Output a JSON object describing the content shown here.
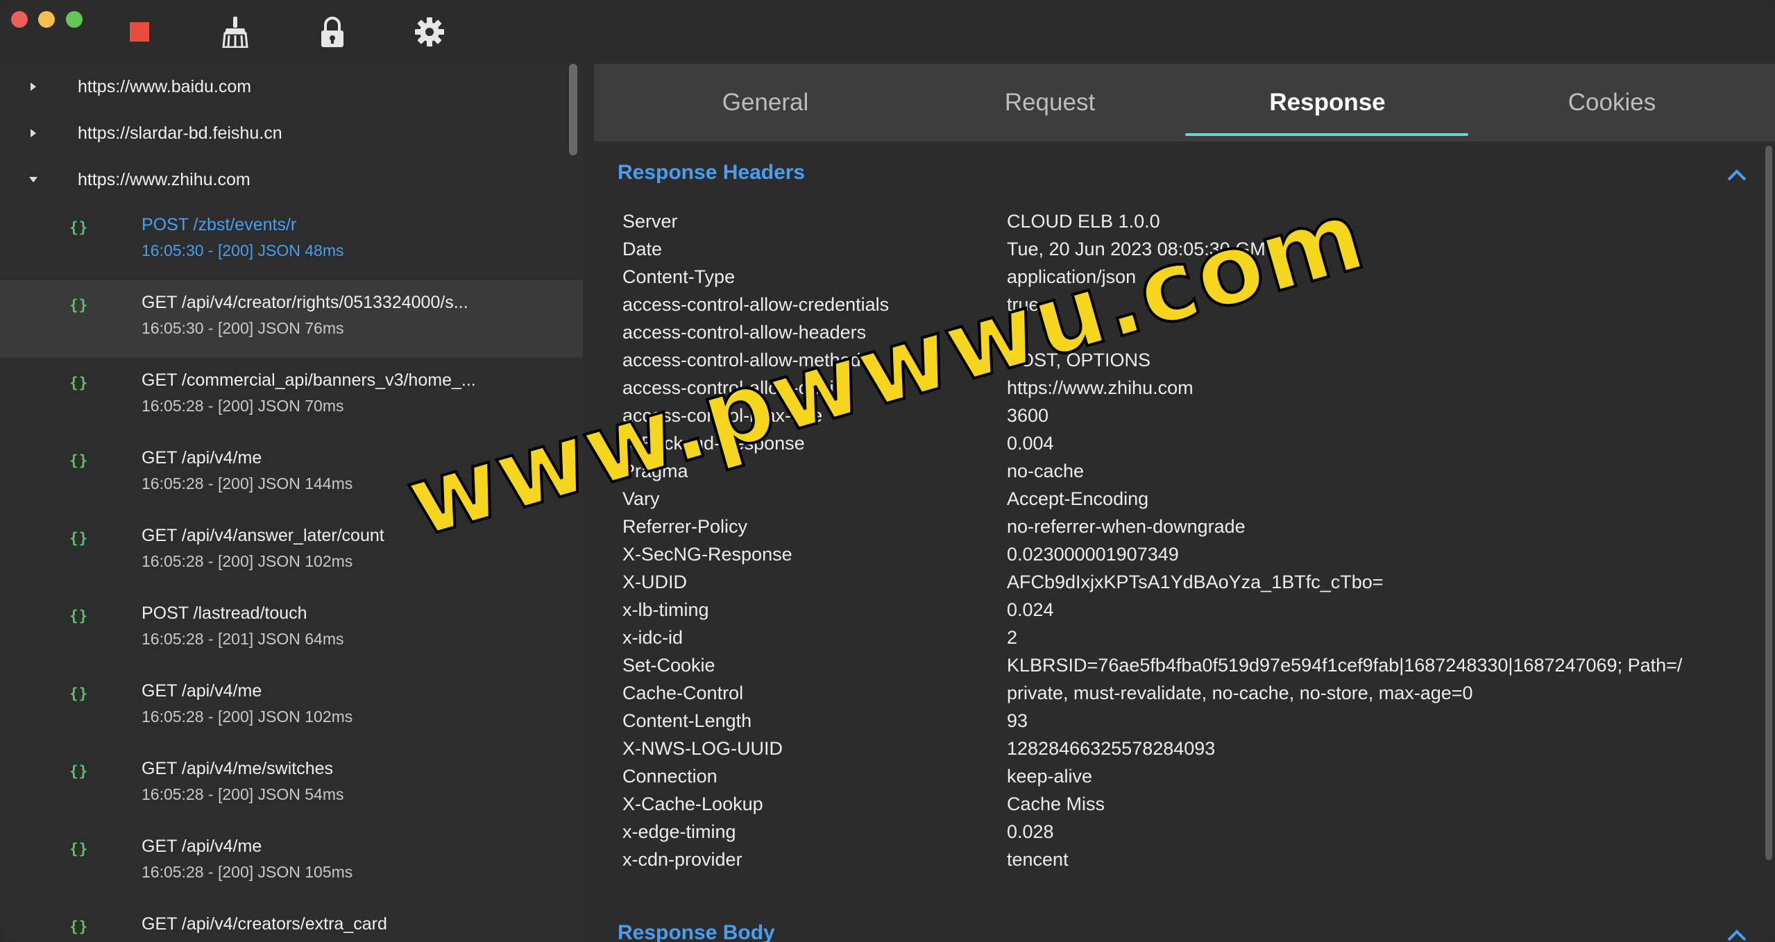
{
  "toolbar": {
    "stop_icon": "stop-icon",
    "clear_icon": "broom-icon",
    "lock_icon": "lock-icon",
    "settings_icon": "gear-icon"
  },
  "domains": [
    {
      "label": "https://www.baidu.com",
      "expanded": false
    },
    {
      "label": "https://slardar-bd.feishu.cn",
      "expanded": false
    },
    {
      "label": "https://www.zhihu.com",
      "expanded": true
    }
  ],
  "requests": [
    {
      "title": "POST /zbst/events/r",
      "meta": "16:05:30 - [200]  JSON 48ms"
    },
    {
      "title": "GET /api/v4/creator/rights/0513324000/s...",
      "meta": "16:05:30 - [200]  JSON 76ms"
    },
    {
      "title": "GET /commercial_api/banners_v3/home_...",
      "meta": "16:05:28 - [200]  JSON 70ms"
    },
    {
      "title": "GET /api/v4/me",
      "meta": "16:05:28 - [200]  JSON 144ms"
    },
    {
      "title": "GET /api/v4/answer_later/count",
      "meta": "16:05:28 - [200]  JSON 102ms"
    },
    {
      "title": "POST /lastread/touch",
      "meta": "16:05:28 - [201]  JSON 64ms"
    },
    {
      "title": "GET /api/v4/me",
      "meta": "16:05:28 - [200]  JSON 102ms"
    },
    {
      "title": "GET /api/v4/me/switches",
      "meta": "16:05:28 - [200]  JSON 54ms"
    },
    {
      "title": "GET /api/v4/me",
      "meta": "16:05:28 - [200]  JSON 105ms"
    },
    {
      "title": "GET /api/v4/creators/extra_card",
      "meta": ""
    }
  ],
  "json_icon_glyph": "{}",
  "tabs": [
    "General",
    "Request",
    "Response",
    "Cookies"
  ],
  "active_tab": "Response",
  "response_headers_title": "Response Headers",
  "response_body_title": "Response Body",
  "headers": [
    {
      "k": "Server",
      "v": "CLOUD ELB 1.0.0"
    },
    {
      "k": "Date",
      "v": "Tue, 20 Jun 2023 08:05:30 GMT"
    },
    {
      "k": "Content-Type",
      "v": "application/json"
    },
    {
      "k": "access-control-allow-credentials",
      "v": "true"
    },
    {
      "k": "access-control-allow-headers",
      "v": ""
    },
    {
      "k": "access-control-allow-methods",
      "v": "POST, OPTIONS"
    },
    {
      "k": "access-control-allow-origin",
      "v": "https://www.zhihu.com"
    },
    {
      "k": "access-control-max-age",
      "v": "3600"
    },
    {
      "k": "X-Backend-Response",
      "v": "0.004"
    },
    {
      "k": "Pragma",
      "v": "no-cache"
    },
    {
      "k": "Vary",
      "v": "Accept-Encoding"
    },
    {
      "k": "Referrer-Policy",
      "v": "no-referrer-when-downgrade"
    },
    {
      "k": "X-SecNG-Response",
      "v": "0.023000001907349"
    },
    {
      "k": "X-UDID",
      "v": "AFCb9dIxjxKPTsA1YdBAoYza_1BTfc_cTbo="
    },
    {
      "k": "x-lb-timing",
      "v": "0.024"
    },
    {
      "k": "x-idc-id",
      "v": "2"
    },
    {
      "k": "Set-Cookie",
      "v": "KLBRSID=76ae5fb4fba0f519d97e594f1cef9fab|1687248330|1687247069; Path=/"
    },
    {
      "k": "Cache-Control",
      "v": "private, must-revalidate, no-cache, no-store, max-age=0"
    },
    {
      "k": "Content-Length",
      "v": "93"
    },
    {
      "k": "X-NWS-LOG-UUID",
      "v": "12828466325578284093"
    },
    {
      "k": "Connection",
      "v": "keep-alive"
    },
    {
      "k": "X-Cache-Lookup",
      "v": "Cache Miss"
    },
    {
      "k": "x-edge-timing",
      "v": "0.028"
    },
    {
      "k": "x-cdn-provider",
      "v": "tencent"
    }
  ],
  "watermark": "www.pwwwu.com",
  "colors": {
    "accent_blue": "#4a9ef0",
    "tab_underline": "#6fd8c2",
    "json_icon": "#5fbf6a",
    "stop_red": "#e84c3d"
  }
}
